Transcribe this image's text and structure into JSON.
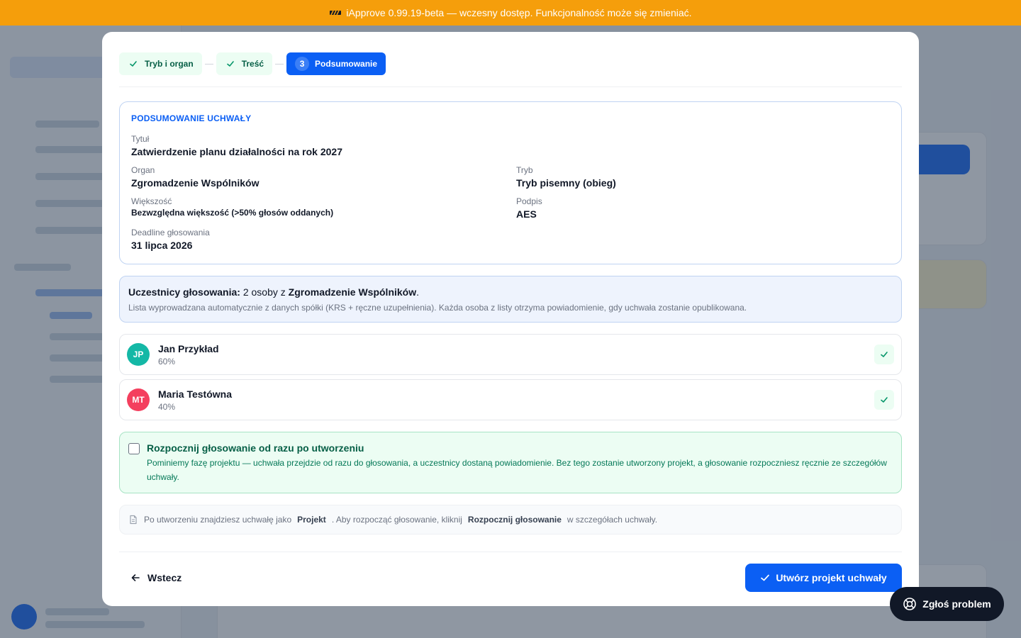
{
  "banner": {
    "text": "iApprove 0.99.19-beta — wczesny dostęp. Funkcjonalność może się zmieniać."
  },
  "stepper": {
    "steps": [
      {
        "label": "Tryb i organ",
        "state": "done"
      },
      {
        "label": "Treść",
        "state": "done"
      },
      {
        "label": "Podsumowanie",
        "state": "active",
        "number": "3"
      }
    ]
  },
  "summary": {
    "title": "PODSUMOWANIE UCHWAŁY",
    "fields": {
      "title_label": "Tytuł",
      "title_value": "Zatwierdzenie planu działalności na rok 2027",
      "organ_label": "Organ",
      "organ_value": "Zgromadzenie Wspólników",
      "mode_label": "Tryb",
      "mode_value": "Tryb pisemny (obieg)",
      "majority_label": "Większość",
      "majority_value": "Bezwzględna większość (>50% głosów oddanych)",
      "signature_label": "Podpis",
      "signature_value": "AES",
      "deadline_label": "Deadline głosowania",
      "deadline_value": "31 lipca 2026"
    }
  },
  "participants": {
    "label": "Uczestnicy głosowania:",
    "count_text": "2 osoby z",
    "organ": "Zgromadzenie Wspólników",
    "period": ".",
    "description": "Lista wyprowadzana automatycznie z danych spółki (KRS + ręczne uzupełnienia). Każda osoba z listy otrzyma powiadomienie, gdy uchwała zostanie opublikowana.",
    "people": [
      {
        "initials": "JP",
        "name": "Jan Przykład",
        "share": "60%",
        "color": "#14b8a6"
      },
      {
        "initials": "MT",
        "name": "Maria Testówna",
        "share": "40%",
        "color": "#f43f5e"
      }
    ]
  },
  "start_option": {
    "checked": false,
    "title": "Rozpocznij głosowanie od razu po utworzeniu",
    "description": "Pominiemy fazę projektu — uchwała przejdzie od razu do głosowania, a uczestnicy dostaną powiadomienie. Bez tego zostanie utworzony projekt, a głosowanie rozpoczniesz ręcznie ze szczegółów uchwały."
  },
  "info": {
    "part1": "Po utworzeniu znajdziesz uchwałę jako",
    "badge1": "Projekt",
    "part2": ". Aby rozpocząć głosowanie, kliknij",
    "badge2": "Rozpocznij głosowanie",
    "part3": "w szczegółach uchwały."
  },
  "footer": {
    "back_label": "Wstecz",
    "create_label": "Utwórz projekt uchwały"
  },
  "report": {
    "label": "Zgłoś problem"
  },
  "colors": {
    "primary": "#0b5ff4",
    "banner": "#f59e0b",
    "success_bg": "#ecfdf3",
    "success_text": "#065f46"
  }
}
